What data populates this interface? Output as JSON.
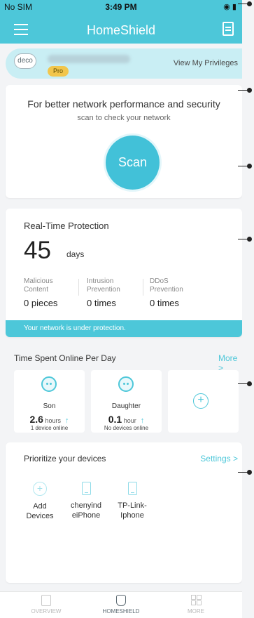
{
  "status_bar": {
    "carrier": "No SIM",
    "time": "3:49 PM",
    "battery": "◉ ▮"
  },
  "header": {
    "title": "HomeShield"
  },
  "privilege": {
    "logo": "deco",
    "badge": "Pro",
    "link": "View My Privileges"
  },
  "scan": {
    "title": "For better network performance and security",
    "subtitle": "scan to check your network",
    "button": "Scan"
  },
  "protection": {
    "title": "Real-Time Protection",
    "days": "45",
    "days_unit": "days",
    "stats": [
      {
        "label_1": "Malicious",
        "label_2": "Content",
        "value": "0 pieces"
      },
      {
        "label_1": "Intrusion",
        "label_2": "Prevention",
        "value": "0 times"
      },
      {
        "label_1": "DDoS",
        "label_2": "Prevention",
        "value": "0 times"
      }
    ],
    "status": "Your network is under protection."
  },
  "time_online": {
    "title": "Time Spent Online Per Day",
    "more": "More >",
    "profiles": [
      {
        "name": "Son",
        "value": "2.6",
        "unit": "hours",
        "devices": "1 device online"
      },
      {
        "name": "Daughter",
        "value": "0.1",
        "unit": "hour",
        "devices": "No devices online"
      }
    ],
    "add": "+"
  },
  "prioritize": {
    "title": "Prioritize your devices",
    "settings": "Settings >",
    "devices": [
      {
        "line1": "Add",
        "line2": "Devices"
      },
      {
        "line1": "chenyind",
        "line2": "eiPhone"
      },
      {
        "line1": "TP-Link-",
        "line2": "Iphone"
      }
    ]
  },
  "tabs": [
    {
      "label": "OVERVIEW"
    },
    {
      "label": "HOMESHIELD"
    },
    {
      "label": "MORE"
    }
  ],
  "colors": {
    "accent": "#4dc7d9",
    "pro_badge": "#f2c64c"
  }
}
